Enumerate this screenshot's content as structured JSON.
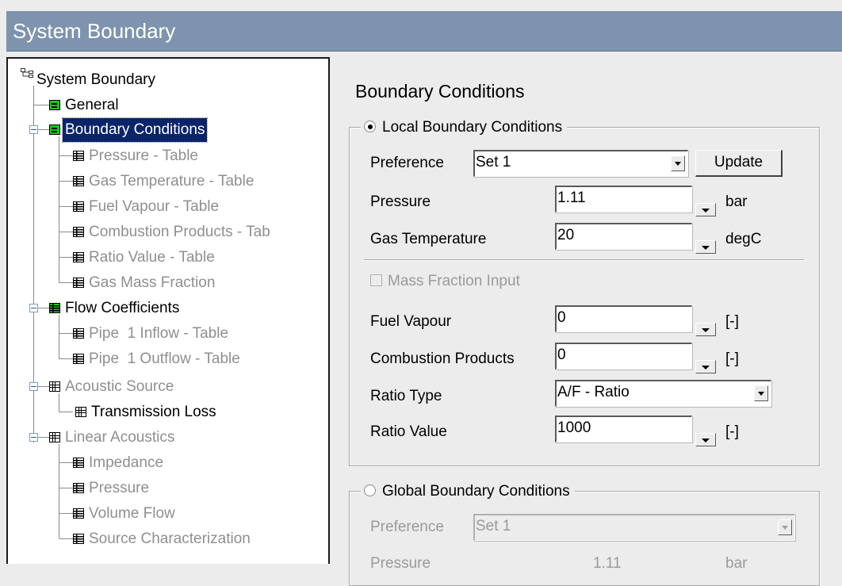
{
  "window": {
    "title": "System Boundary"
  },
  "tree": {
    "root": "System Boundary",
    "items": [
      {
        "label": "General",
        "icon": "green-form-icon",
        "disabled": false
      },
      {
        "label": "Boundary Conditions",
        "icon": "green-form-icon",
        "disabled": false,
        "selected": true,
        "expanded": true
      },
      {
        "label": "Pressure - Table",
        "icon": "table-icon",
        "disabled": true
      },
      {
        "label": "Gas Temperature - Table",
        "icon": "table-icon",
        "disabled": true
      },
      {
        "label": "Fuel Vapour - Table",
        "icon": "table-icon",
        "disabled": true
      },
      {
        "label": "Combustion Products - Tab",
        "icon": "table-icon",
        "disabled": true
      },
      {
        "label": "Ratio Value - Table",
        "icon": "table-icon",
        "disabled": true
      },
      {
        "label": "Gas Mass Fraction",
        "icon": "table-icon",
        "disabled": true
      },
      {
        "label": "Flow Coefficients",
        "icon": "green-table-icon",
        "disabled": false,
        "expanded": true
      },
      {
        "label": "Pipe  1 Inflow - Table",
        "icon": "table-icon",
        "disabled": true
      },
      {
        "label": "Pipe  1 Outflow - Table",
        "icon": "table-icon",
        "disabled": true
      },
      {
        "label": "Acoustic Source",
        "icon": "grid-icon",
        "disabled": true,
        "expanded": true
      },
      {
        "label": "Transmission Loss",
        "icon": "grid-icon",
        "disabled": false
      },
      {
        "label": "Linear Acoustics",
        "icon": "grid-icon",
        "disabled": true,
        "expanded": true
      },
      {
        "label": "Impedance",
        "icon": "table-icon",
        "disabled": true
      },
      {
        "label": "Pressure",
        "icon": "table-icon",
        "disabled": true
      },
      {
        "label": "Volume Flow",
        "icon": "table-icon",
        "disabled": true
      },
      {
        "label": "Source Characterization",
        "icon": "table-icon",
        "disabled": true
      }
    ]
  },
  "panel": {
    "heading": "Boundary Conditions",
    "local": {
      "legend": "Local Boundary Conditions",
      "selected": true,
      "preference_label": "Preference",
      "preference_value": "Set 1",
      "update_label": "Update",
      "pressure_label": "Pressure",
      "pressure_value": "1.11",
      "pressure_unit": "bar",
      "gas_temp_label": "Gas Temperature",
      "gas_temp_value": "20",
      "gas_temp_unit": "degC",
      "mass_fraction_label": "Mass Fraction Input",
      "fuel_vapour_label": "Fuel Vapour",
      "fuel_vapour_value": "0",
      "fuel_vapour_unit": "[-]",
      "comb_products_label": "Combustion Products",
      "comb_products_value": "0",
      "comb_products_unit": "[-]",
      "ratio_type_label": "Ratio Type",
      "ratio_type_value": "A/F - Ratio",
      "ratio_value_label": "Ratio Value",
      "ratio_value_value": "1000",
      "ratio_value_unit": "[-]"
    },
    "global": {
      "legend": "Global Boundary Conditions",
      "selected": false,
      "preference_label": "Preference",
      "preference_value": "Set 1",
      "pressure_label": "Pressure",
      "pressure_value": "1.11",
      "pressure_unit": "bar"
    }
  },
  "colors": {
    "titlebar": "#7e93ad",
    "selection": "#0a246a",
    "background": "#ececec",
    "green_icon": "#19c619"
  }
}
